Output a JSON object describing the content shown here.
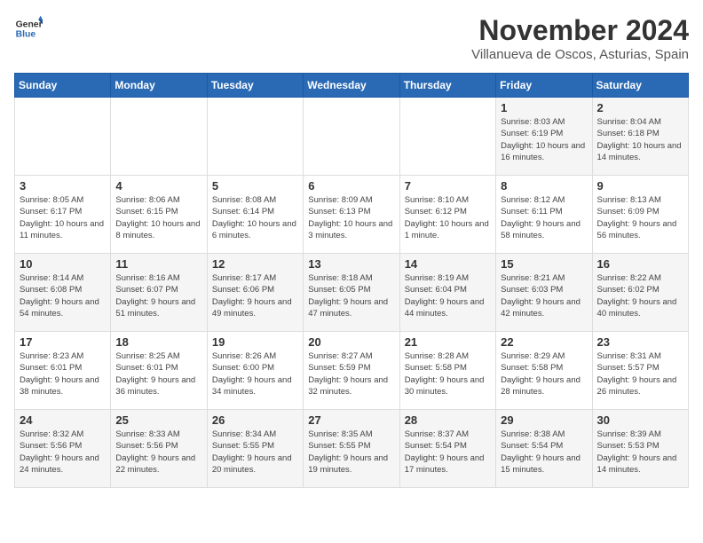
{
  "header": {
    "logo_general": "General",
    "logo_blue": "Blue",
    "month": "November 2024",
    "location": "Villanueva de Oscos, Asturias, Spain"
  },
  "weekdays": [
    "Sunday",
    "Monday",
    "Tuesday",
    "Wednesday",
    "Thursday",
    "Friday",
    "Saturday"
  ],
  "weeks": [
    [
      {
        "day": "",
        "info": ""
      },
      {
        "day": "",
        "info": ""
      },
      {
        "day": "",
        "info": ""
      },
      {
        "day": "",
        "info": ""
      },
      {
        "day": "",
        "info": ""
      },
      {
        "day": "1",
        "info": "Sunrise: 8:03 AM\nSunset: 6:19 PM\nDaylight: 10 hours and 16 minutes."
      },
      {
        "day": "2",
        "info": "Sunrise: 8:04 AM\nSunset: 6:18 PM\nDaylight: 10 hours and 14 minutes."
      }
    ],
    [
      {
        "day": "3",
        "info": "Sunrise: 8:05 AM\nSunset: 6:17 PM\nDaylight: 10 hours and 11 minutes."
      },
      {
        "day": "4",
        "info": "Sunrise: 8:06 AM\nSunset: 6:15 PM\nDaylight: 10 hours and 8 minutes."
      },
      {
        "day": "5",
        "info": "Sunrise: 8:08 AM\nSunset: 6:14 PM\nDaylight: 10 hours and 6 minutes."
      },
      {
        "day": "6",
        "info": "Sunrise: 8:09 AM\nSunset: 6:13 PM\nDaylight: 10 hours and 3 minutes."
      },
      {
        "day": "7",
        "info": "Sunrise: 8:10 AM\nSunset: 6:12 PM\nDaylight: 10 hours and 1 minute."
      },
      {
        "day": "8",
        "info": "Sunrise: 8:12 AM\nSunset: 6:11 PM\nDaylight: 9 hours and 58 minutes."
      },
      {
        "day": "9",
        "info": "Sunrise: 8:13 AM\nSunset: 6:09 PM\nDaylight: 9 hours and 56 minutes."
      }
    ],
    [
      {
        "day": "10",
        "info": "Sunrise: 8:14 AM\nSunset: 6:08 PM\nDaylight: 9 hours and 54 minutes."
      },
      {
        "day": "11",
        "info": "Sunrise: 8:16 AM\nSunset: 6:07 PM\nDaylight: 9 hours and 51 minutes."
      },
      {
        "day": "12",
        "info": "Sunrise: 8:17 AM\nSunset: 6:06 PM\nDaylight: 9 hours and 49 minutes."
      },
      {
        "day": "13",
        "info": "Sunrise: 8:18 AM\nSunset: 6:05 PM\nDaylight: 9 hours and 47 minutes."
      },
      {
        "day": "14",
        "info": "Sunrise: 8:19 AM\nSunset: 6:04 PM\nDaylight: 9 hours and 44 minutes."
      },
      {
        "day": "15",
        "info": "Sunrise: 8:21 AM\nSunset: 6:03 PM\nDaylight: 9 hours and 42 minutes."
      },
      {
        "day": "16",
        "info": "Sunrise: 8:22 AM\nSunset: 6:02 PM\nDaylight: 9 hours and 40 minutes."
      }
    ],
    [
      {
        "day": "17",
        "info": "Sunrise: 8:23 AM\nSunset: 6:01 PM\nDaylight: 9 hours and 38 minutes."
      },
      {
        "day": "18",
        "info": "Sunrise: 8:25 AM\nSunset: 6:01 PM\nDaylight: 9 hours and 36 minutes."
      },
      {
        "day": "19",
        "info": "Sunrise: 8:26 AM\nSunset: 6:00 PM\nDaylight: 9 hours and 34 minutes."
      },
      {
        "day": "20",
        "info": "Sunrise: 8:27 AM\nSunset: 5:59 PM\nDaylight: 9 hours and 32 minutes."
      },
      {
        "day": "21",
        "info": "Sunrise: 8:28 AM\nSunset: 5:58 PM\nDaylight: 9 hours and 30 minutes."
      },
      {
        "day": "22",
        "info": "Sunrise: 8:29 AM\nSunset: 5:58 PM\nDaylight: 9 hours and 28 minutes."
      },
      {
        "day": "23",
        "info": "Sunrise: 8:31 AM\nSunset: 5:57 PM\nDaylight: 9 hours and 26 minutes."
      }
    ],
    [
      {
        "day": "24",
        "info": "Sunrise: 8:32 AM\nSunset: 5:56 PM\nDaylight: 9 hours and 24 minutes."
      },
      {
        "day": "25",
        "info": "Sunrise: 8:33 AM\nSunset: 5:56 PM\nDaylight: 9 hours and 22 minutes."
      },
      {
        "day": "26",
        "info": "Sunrise: 8:34 AM\nSunset: 5:55 PM\nDaylight: 9 hours and 20 minutes."
      },
      {
        "day": "27",
        "info": "Sunrise: 8:35 AM\nSunset: 5:55 PM\nDaylight: 9 hours and 19 minutes."
      },
      {
        "day": "28",
        "info": "Sunrise: 8:37 AM\nSunset: 5:54 PM\nDaylight: 9 hours and 17 minutes."
      },
      {
        "day": "29",
        "info": "Sunrise: 8:38 AM\nSunset: 5:54 PM\nDaylight: 9 hours and 15 minutes."
      },
      {
        "day": "30",
        "info": "Sunrise: 8:39 AM\nSunset: 5:53 PM\nDaylight: 9 hours and 14 minutes."
      }
    ]
  ]
}
